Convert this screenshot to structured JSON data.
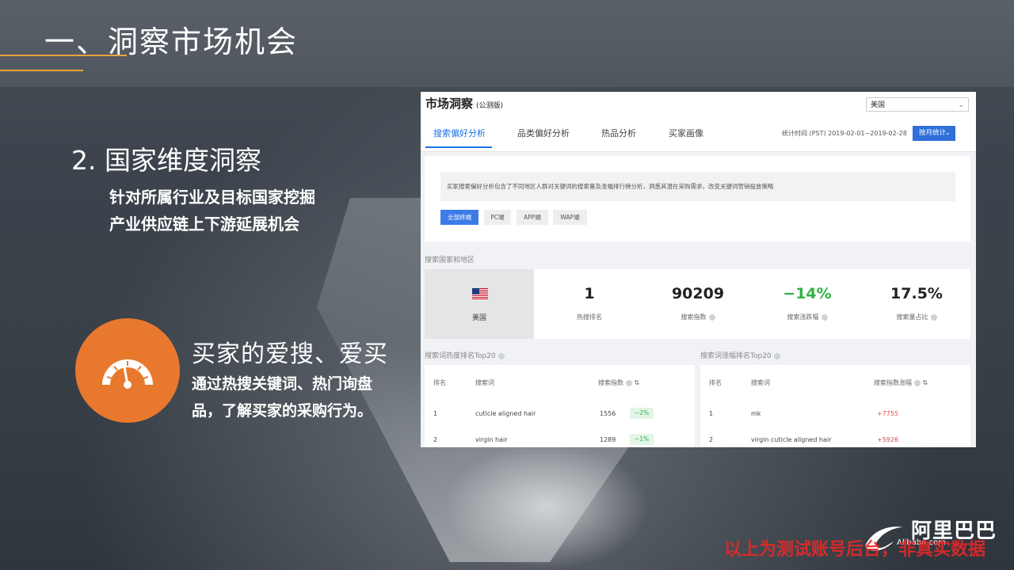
{
  "slide": {
    "title": "一、洞察市场机会",
    "section_heading": "2. 国家维度洞察",
    "section_subtitle": "针对所属行业及目标国家挖掘产业供应链上下游延展机会",
    "feature_title": "买家的爱搜、爱买",
    "feature_description": "通过热搜关键词、热门询盘品，了解买家的采购行为。",
    "watermark": "以上为测试账号后台，非真实数据",
    "logo_cn": "阿里巴巴",
    "logo_en": "Alibaba.com",
    "accent_color": "#e6a23c",
    "icon_circle_color": "#e8782e",
    "feature_icon": "speedometer-icon"
  },
  "screenshot": {
    "page_title": "市场洞察",
    "page_title_tag": "(公测版)",
    "country_select": "美国",
    "tabs": [
      "搜索偏好分析",
      "品类偏好分析",
      "热品分析",
      "买家画像"
    ],
    "active_tab": "搜索偏好分析",
    "stat_time": "统计时间 (PST) 2019-02-01~2019-02-28",
    "stat_button": "按月统计",
    "info_text": "买家搜索偏好分析包含了不同地区人群对关键词的搜索量及涨幅排行榜分析，洞悉其潜在采购需求，改变关键词营销投放策略",
    "terminal_chips": [
      "全部终端",
      "PC端",
      "APP端",
      "WAP端"
    ],
    "region_section_label": "搜索国家和地区",
    "region": {
      "flag_icon": "us-flag-icon",
      "name": "美国",
      "metrics": [
        {
          "value": "1",
          "label": "热搜排名"
        },
        {
          "value": "90209",
          "label": "搜索指数"
        },
        {
          "value": "−14%",
          "label": "搜索涨跌幅"
        },
        {
          "value": "17.5%",
          "label": "搜索量占比"
        }
      ]
    },
    "hot_table": {
      "label": "搜索词热度排名Top20",
      "headers": [
        "排名",
        "搜索词",
        "搜索指数"
      ],
      "rows": [
        {
          "rank": "1",
          "term": "cuticle aligned hair",
          "index": "1556",
          "change": "−2%"
        },
        {
          "rank": "2",
          "term": "virgin hair",
          "index": "1289",
          "change": "−1%"
        }
      ]
    },
    "rise_table": {
      "label": "搜索词涨幅排名Top20",
      "headers": [
        "排名",
        "搜索词",
        "搜索指数涨幅"
      ],
      "rows": [
        {
          "rank": "1",
          "term": "mk",
          "change": "+7755"
        },
        {
          "rank": "2",
          "term": "virgin cuticle aligned hair",
          "change": "+5926"
        }
      ]
    },
    "colors": {
      "primary": "#1a73e8",
      "positive": "#2fb344",
      "negative": "#e64545"
    }
  }
}
